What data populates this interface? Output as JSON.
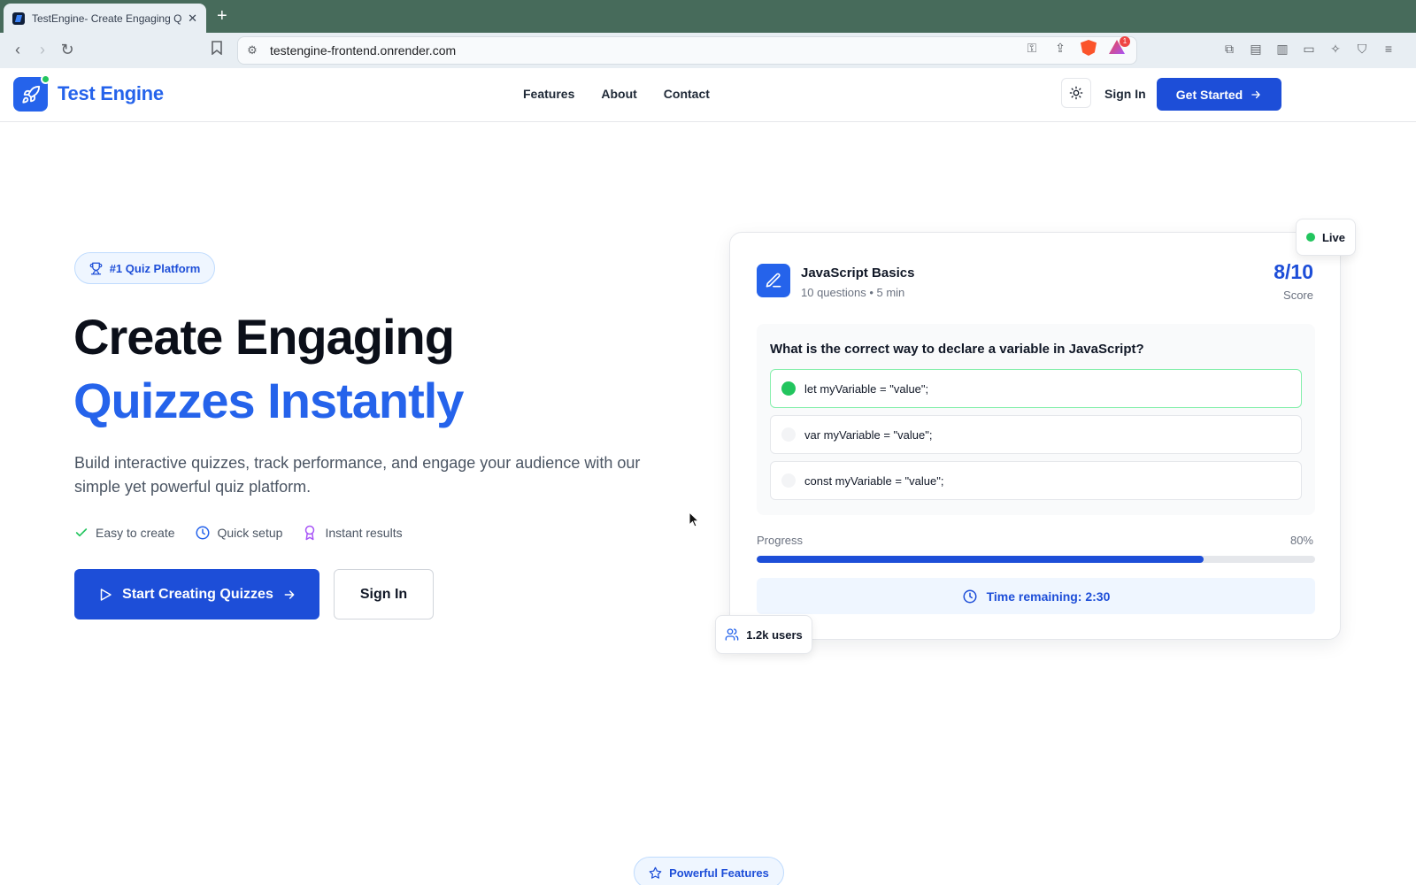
{
  "browser": {
    "tab_title": "TestEngine- Create Engaging Q",
    "new_tab_symbol": "+",
    "url": "testengine-frontend.onrender.com",
    "rewards_badge": "1"
  },
  "header": {
    "brand": "Test Engine",
    "nav": [
      "Features",
      "About",
      "Contact"
    ],
    "sign_in": "Sign In",
    "get_started": "Get Started"
  },
  "hero": {
    "badge": "#1 Quiz Platform",
    "title_line1": "Create Engaging",
    "title_line2": "Quizzes Instantly",
    "description": "Build interactive quizzes, track performance, and engage your audience with our simple yet powerful quiz platform.",
    "features": [
      "Easy to create",
      "Quick setup",
      "Instant results"
    ],
    "cta_primary": "Start Creating Quizzes",
    "cta_secondary": "Sign In"
  },
  "quiz_card": {
    "title": "JavaScript Basics",
    "meta": "10 questions • 5 min",
    "score": "8/10",
    "score_label": "Score",
    "question": "What is the correct way to declare a variable in JavaScript?",
    "options": [
      "let myVariable = \"value\";",
      "var myVariable = \"value\";",
      "const myVariable = \"value\";"
    ],
    "progress_label": "Progress",
    "progress_value": "80%",
    "progress_fraction": 0.8,
    "timer": "Time remaining: 2:30",
    "live_label": "Live",
    "users_label": "1.2k users"
  },
  "next_section": {
    "badge": "Powerful Features"
  },
  "colors": {
    "primary": "#1d4ed8",
    "accent": "#2563eb",
    "success": "#22c55e"
  }
}
